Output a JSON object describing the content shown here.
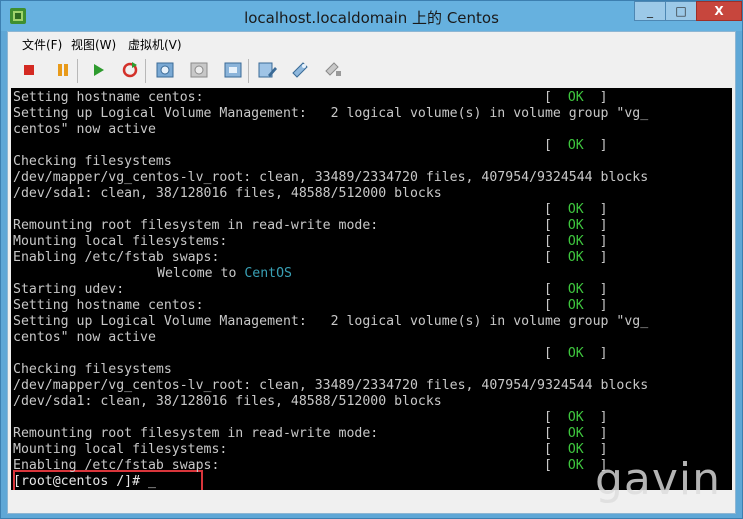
{
  "window": {
    "title": "localhost.localdomain 上的 Centos",
    "minimize_label": "_",
    "maximize_label": "□",
    "close_label": "X"
  },
  "menu": [
    {
      "label": "文件(F)"
    },
    {
      "label": "视图(W)"
    },
    {
      "label": "虚拟机(V)"
    }
  ],
  "toolbar": {
    "icons": [
      "stop-icon",
      "pause-icon",
      "play-icon",
      "reset-icon",
      "snapshot-icon",
      "revert-snapshot-icon",
      "manage-snapshots-icon",
      "edit-settings-icon",
      "install-tools-icon",
      "connect-device-icon"
    ]
  },
  "console": {
    "lines": [
      {
        "text": "Setting hostname centos:",
        "ok": true
      },
      {
        "text": "Setting up Logical Volume Management:   2 logical volume(s) in volume group \"vg_",
        "ok": false
      },
      {
        "text": "centos\" now active",
        "ok": false
      },
      {
        "text": "",
        "ok": true
      },
      {
        "text": "Checking filesystems",
        "ok": false
      },
      {
        "text": "/dev/mapper/vg_centos-lv_root: clean, 33489/2334720 files, 407954/9324544 blocks",
        "ok": false
      },
      {
        "text": "/dev/sda1: clean, 38/128016 files, 48588/512000 blocks",
        "ok": false
      },
      {
        "text": "",
        "ok": true
      },
      {
        "text": "Remounting root filesystem in read-write mode:",
        "ok": true
      },
      {
        "text": "Mounting local filesystems:",
        "ok": true
      },
      {
        "text": "Enabling /etc/fstab swaps:",
        "ok": true
      },
      {
        "text": "",
        "ok": false,
        "welcome": true
      },
      {
        "text": "Starting udev:",
        "ok": true
      },
      {
        "text": "Setting hostname centos:",
        "ok": true
      },
      {
        "text": "Setting up Logical Volume Management:   2 logical volume(s) in volume group \"vg_",
        "ok": false
      },
      {
        "text": "centos\" now active",
        "ok": false
      },
      {
        "text": "",
        "ok": true
      },
      {
        "text": "Checking filesystems",
        "ok": false
      },
      {
        "text": "/dev/mapper/vg_centos-lv_root: clean, 33489/2334720 files, 407954/9324544 blocks",
        "ok": false
      },
      {
        "text": "/dev/sda1: clean, 38/128016 files, 48588/512000 blocks",
        "ok": false
      },
      {
        "text": "",
        "ok": true
      },
      {
        "text": "Remounting root filesystem in read-write mode:",
        "ok": true
      },
      {
        "text": "Mounting local filesystems:",
        "ok": true
      },
      {
        "text": "Enabling /etc/fstab swaps:",
        "ok": true
      }
    ],
    "welcome_prefix": "Welcome to ",
    "welcome_name": "CentOS",
    "ok_bracket_left": "[  ",
    "ok_word": "OK",
    "ok_bracket_right": "  ]",
    "prompt": "[root@centos /]# _"
  },
  "watermark": "gavin",
  "colors": {
    "ok": "#3ec63e",
    "centos": "#39a0b5",
    "highlight": "#d9353b",
    "titlebar": "#66b1df"
  }
}
